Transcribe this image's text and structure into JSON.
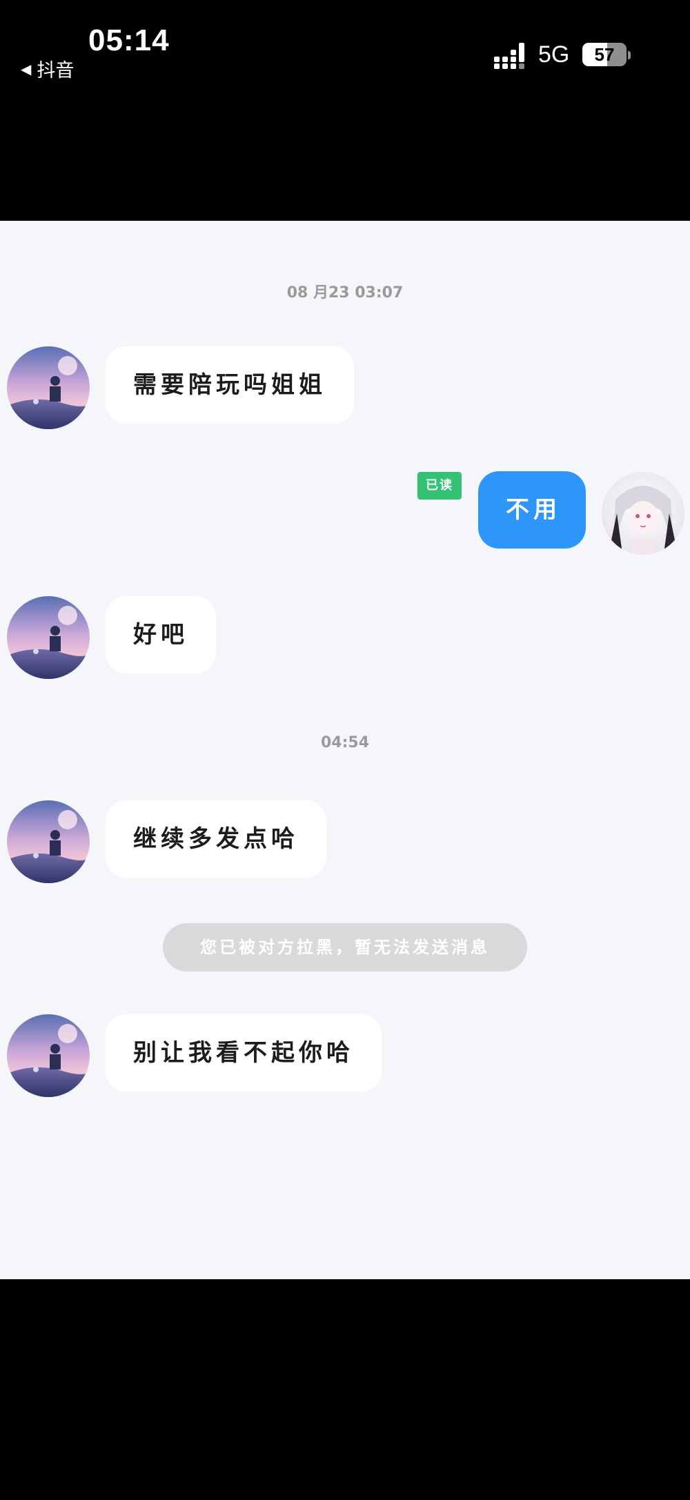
{
  "status_bar": {
    "time": "05:14",
    "back_app_label": "抖音",
    "network": "5G",
    "battery_level": "57",
    "battery_fraction": 0.57,
    "signal_icon": "signal-icon",
    "battery_icon": "battery-icon"
  },
  "chat": {
    "timestamps": [
      "08 月23  03:07",
      "04:54"
    ],
    "messages": [
      {
        "direction": "incoming",
        "text": "需要陪玩吗姐姐"
      },
      {
        "direction": "outgoing",
        "text": "不用",
        "read_label": "已读"
      },
      {
        "direction": "incoming",
        "text": "好吧"
      },
      {
        "direction": "incoming",
        "text": "继续多发点哈"
      },
      {
        "direction": "incoming",
        "text": "别让我看不起你哈"
      }
    ],
    "system_notice": "您已被对方拉黑，暂无法发送消息"
  },
  "colors": {
    "chat_background": "#f4f6f9",
    "incoming_bubble": "#ffffff",
    "outgoing_bubble": "#2d96f8",
    "read_badge": "#34c274",
    "system_notice_bg": "#d9d9db"
  }
}
